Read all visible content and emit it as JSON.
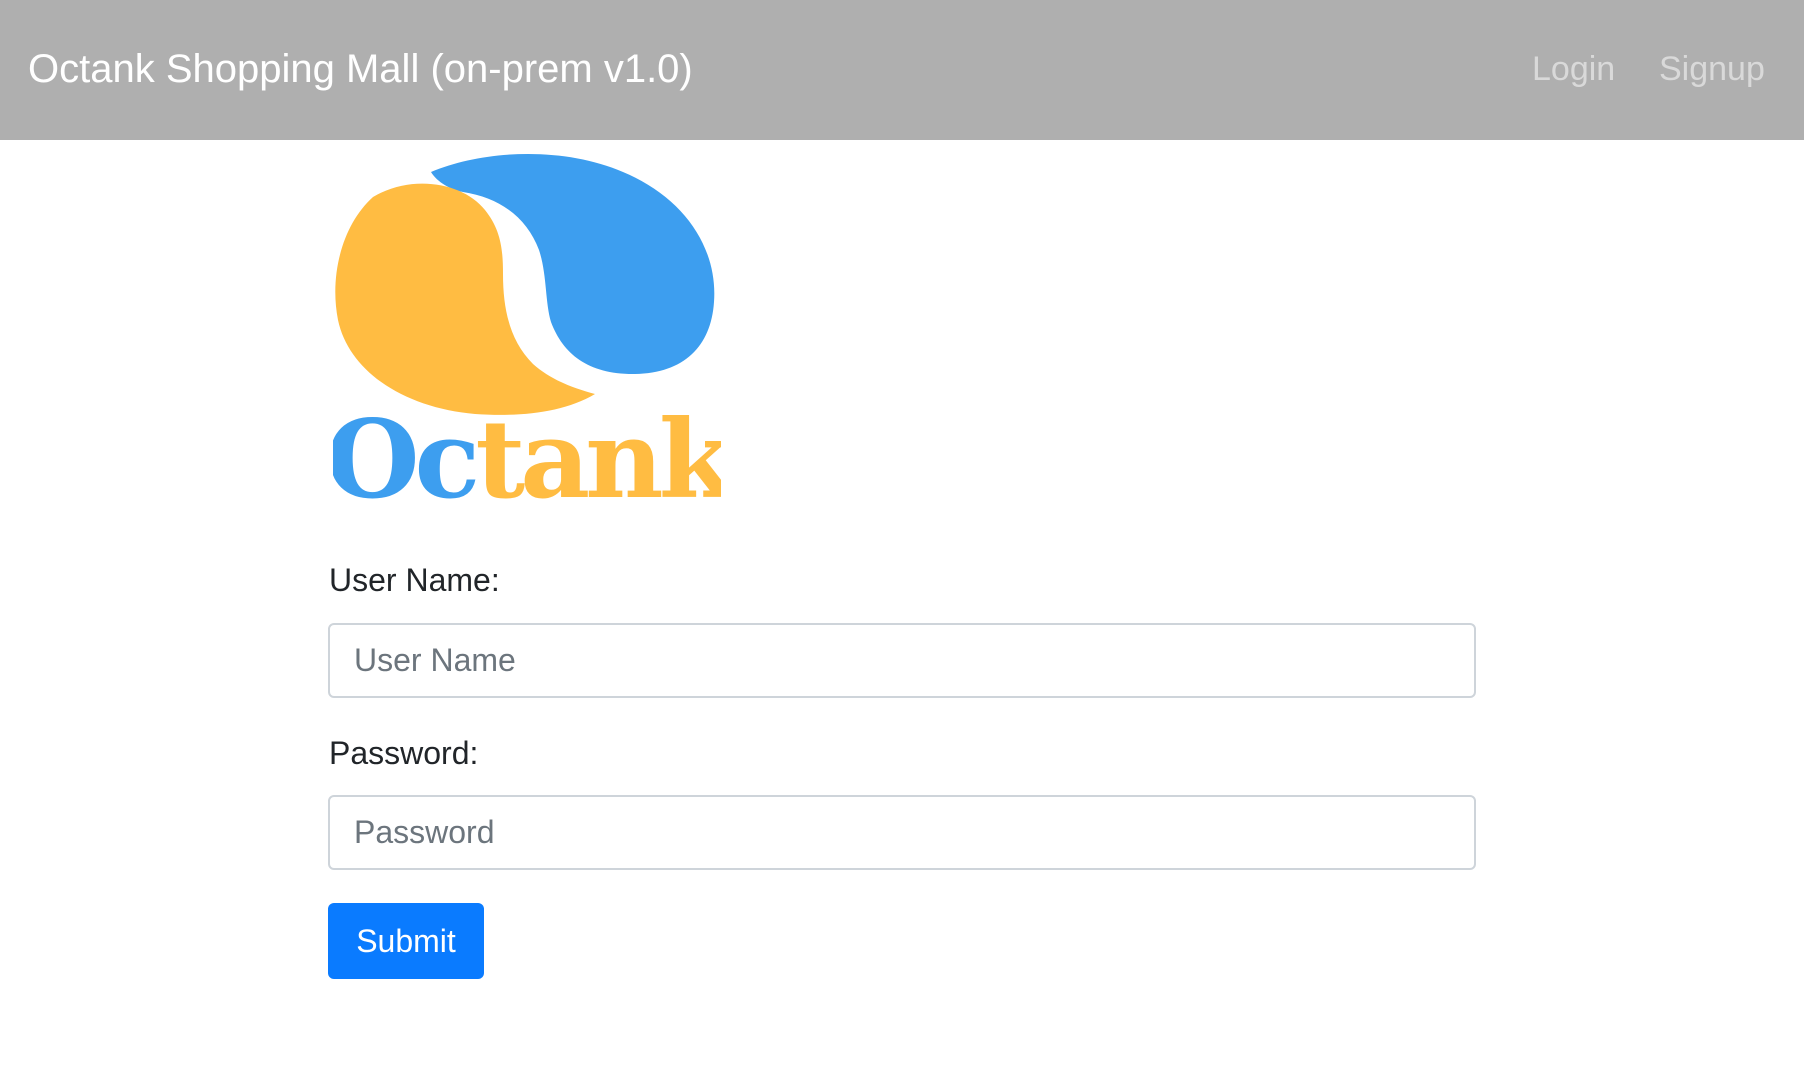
{
  "navbar": {
    "brand": "Octank Shopping Mall (on-prem v1.0)",
    "links": [
      {
        "label": "Login"
      },
      {
        "label": "Signup"
      }
    ]
  },
  "logo": {
    "text_part1": "Oc",
    "text_part2": "tank",
    "colors": {
      "blue": "#3d9eef",
      "orange": "#ffbc42"
    }
  },
  "form": {
    "username": {
      "label": "User Name:",
      "placeholder": "User Name",
      "value": ""
    },
    "password": {
      "label": "Password:",
      "placeholder": "Password",
      "value": ""
    },
    "submit_label": "Submit"
  },
  "colors": {
    "navbar_bg": "#afafaf",
    "brand_text": "#ffffff",
    "nav_link": "#d9d9d9",
    "button_bg": "#0a7bff"
  }
}
